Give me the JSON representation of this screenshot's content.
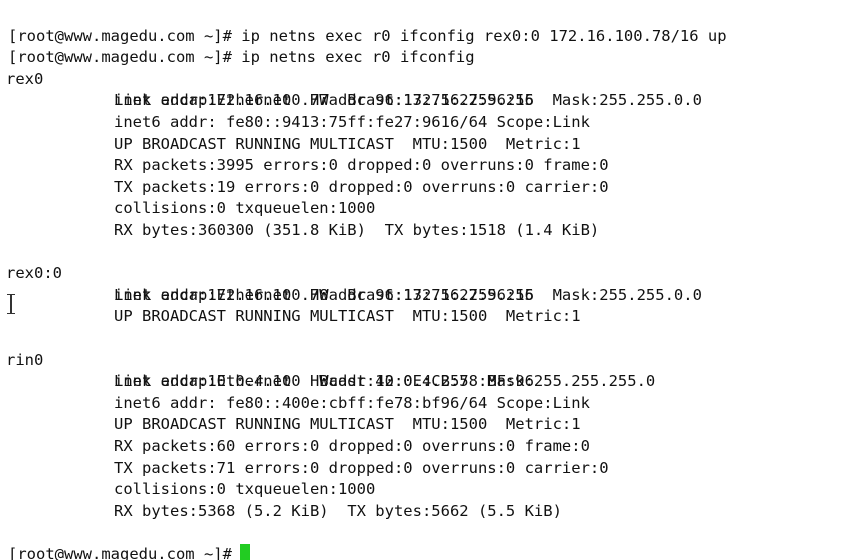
{
  "terminal": {
    "prompt": "[root@www.magedu.com ~]#",
    "cursor_color": "#22cc22",
    "commands": [
      " ip netns exec r0 ifconfig rex0:0 172.16.100.78/16 up",
      " ip netns exec r0 ifconfig"
    ],
    "interfaces": [
      {
        "name": "rex0",
        "lines": [
          "Link encap:Ethernet  HWaddr 96:13:75:27:96:16",
          "inet addr:172.16.100.77  Bcast:172.16.255.255  Mask:255.255.0.0",
          "inet6 addr: fe80::9413:75ff:fe27:9616/64 Scope:Link",
          "UP BROADCAST RUNNING MULTICAST  MTU:1500  Metric:1",
          "RX packets:3995 errors:0 dropped:0 overruns:0 frame:0",
          "TX packets:19 errors:0 dropped:0 overruns:0 carrier:0",
          "collisions:0 txqueuelen:1000",
          "RX bytes:360300 (351.8 KiB)  TX bytes:1518 (1.4 KiB)"
        ]
      },
      {
        "name": "rex0:0",
        "lines": [
          "Link encap:Ethernet  HWaddr 96:13:75:27:96:16",
          "inet addr:172.16.100.78  Bcast:172.16.255.255  Mask:255.255.0.0",
          "UP BROADCAST RUNNING MULTICAST  MTU:1500  Metric:1"
        ]
      },
      {
        "name": "rin0",
        "lines": [
          "Link encap:Ethernet  HWaddr 42:0E:CB:78:BF:96",
          "inet addr:10.0.4.100  Bcast:10.0.4.255  Mask:255.255.255.0",
          "inet6 addr: fe80::400e:cbff:fe78:bf96/64 Scope:Link",
          "UP BROADCAST RUNNING MULTICAST  MTU:1500  Metric:1",
          "RX packets:60 errors:0 dropped:0 overruns:0 frame:0",
          "TX packets:71 errors:0 dropped:0 overruns:0 carrier:0",
          "collisions:0 txqueuelen:1000",
          "RX bytes:5368 (5.2 KiB)  TX bytes:5662 (5.5 KiB)"
        ]
      }
    ]
  }
}
